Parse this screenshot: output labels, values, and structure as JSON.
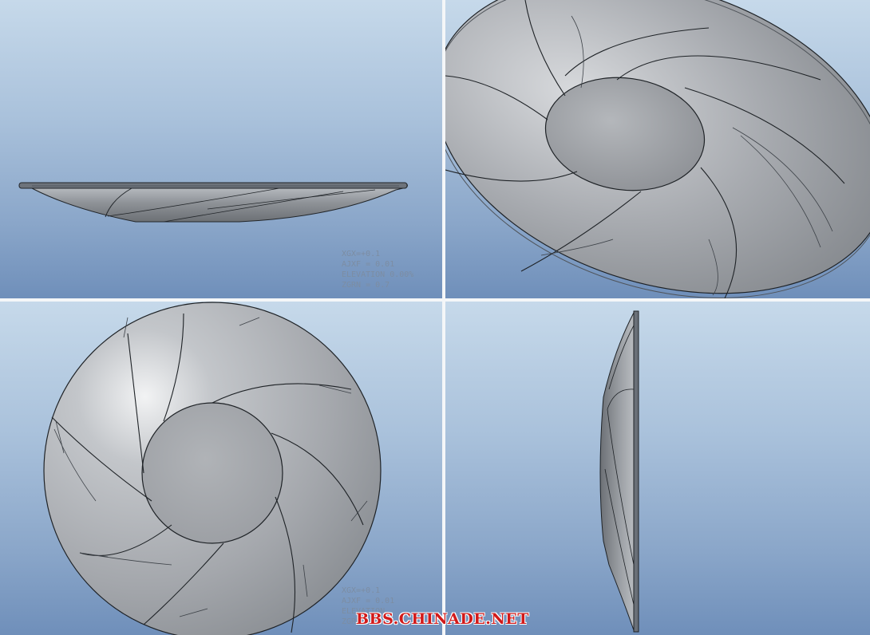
{
  "toolbar": {
    "buttons": [
      {
        "icon": "refit-icon",
        "active": false
      },
      {
        "icon": "zoom-in-icon",
        "active": false
      },
      {
        "icon": "zoom-out-icon",
        "active": false
      },
      {
        "icon": "repaint-icon",
        "active": false
      },
      {
        "icon": "display-style-icon",
        "active": false
      },
      {
        "icon": "saved-orientations-icon",
        "active": false
      },
      {
        "icon": "view-manager-icon",
        "active": false
      },
      {
        "icon": "datum-display-icon",
        "active": false
      },
      {
        "icon": "annotation-display-icon",
        "active": false
      },
      {
        "icon": "spin-center-icon",
        "active": false
      },
      {
        "icon": "perspective-icon",
        "active": false
      },
      {
        "icon": "split-viewports-icon",
        "active": true
      },
      {
        "icon": "swap-viewport-icon",
        "active": false
      },
      {
        "icon": "viewport-layout-icon",
        "active": false
      },
      {
        "icon": "section-view-icon",
        "active": false
      }
    ]
  },
  "viewports": {
    "top_left": {
      "name": "front-view",
      "csys_lines": [
        "XGX=+0.1",
        "AJXF = 0.01",
        "ELEVATION 0.00%",
        "ZGRN = 0.7"
      ]
    },
    "top_right": {
      "name": "isometric-view"
    },
    "bottom_left": {
      "name": "top-view",
      "csys_lines": [
        "XGX=+0.1",
        "AJXF = 0.01",
        "ELEVATION",
        "ZGRN = 0.7"
      ]
    },
    "bottom_right": {
      "name": "side-view"
    }
  },
  "watermark": "BBS.CHINADE.NET",
  "colors": {
    "background_top": "#c6d9ea",
    "background_bottom": "#6f8fba",
    "part_gray": "#a3a6ab",
    "edge": "#1e2226"
  }
}
